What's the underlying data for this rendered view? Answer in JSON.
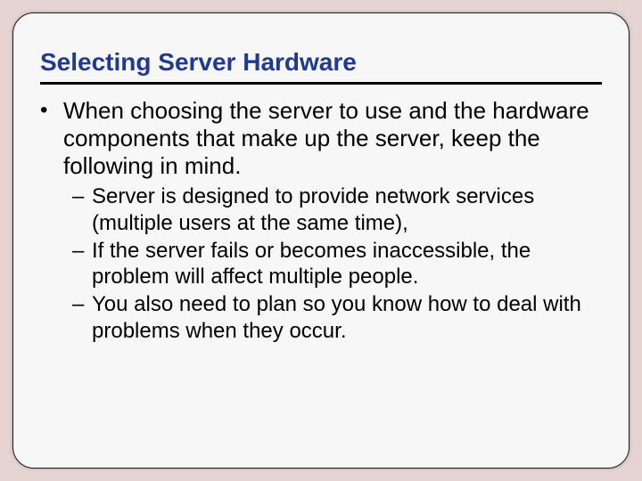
{
  "title": "Selecting Server Hardware",
  "bullet_glyph": "•",
  "dash_glyph": "–",
  "main_bullet": "When choosing the server to use and the hardware components that make up the server, keep the following in mind.",
  "sub_bullets": [
    "Server is designed to provide network services (multiple users at the same time),",
    "If the server fails or becomes inaccessible, the problem will affect multiple people.",
    "You also need to plan so you know how to deal with problems when they occur."
  ]
}
